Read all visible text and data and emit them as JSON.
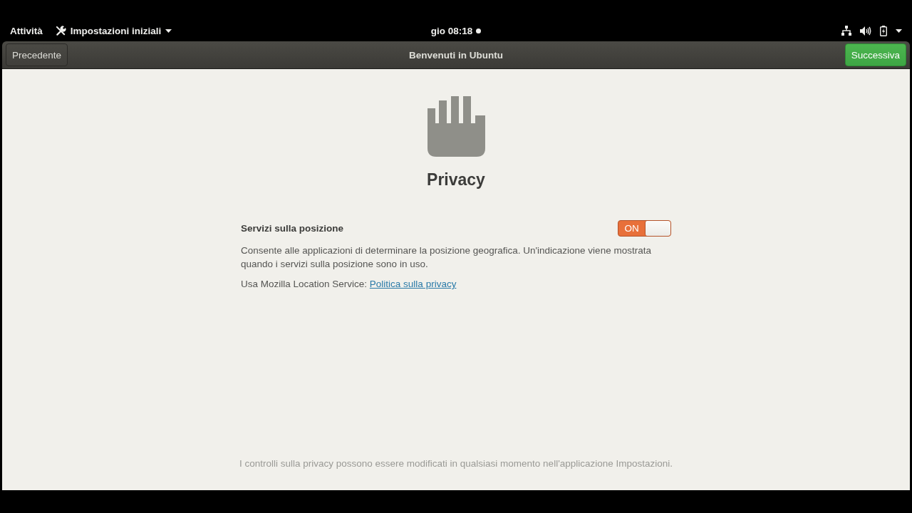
{
  "top_bar": {
    "activities": "Attività",
    "app_menu": "Impostazioni iniziali",
    "clock": "gio 08:18"
  },
  "header_bar": {
    "back_button": "Precedente",
    "title": "Benvenuti in Ubuntu",
    "next_button": "Successiva"
  },
  "page": {
    "title": "Privacy",
    "setting": {
      "label": "Servizi sulla posizione",
      "on": true,
      "switch_label": "ON",
      "description": "Consente alle applicazioni di determinare la posizione geografica. Un'indicazione viene mostrata quando i servizi sulla posizione sono in uso.",
      "service_text": "Usa Mozilla Location Service:",
      "link": "Politica sulla privacy"
    },
    "footer": "I controlli sulla privacy possono essere modificati in qualsiasi momento nell'applicazione Impostazioni."
  }
}
